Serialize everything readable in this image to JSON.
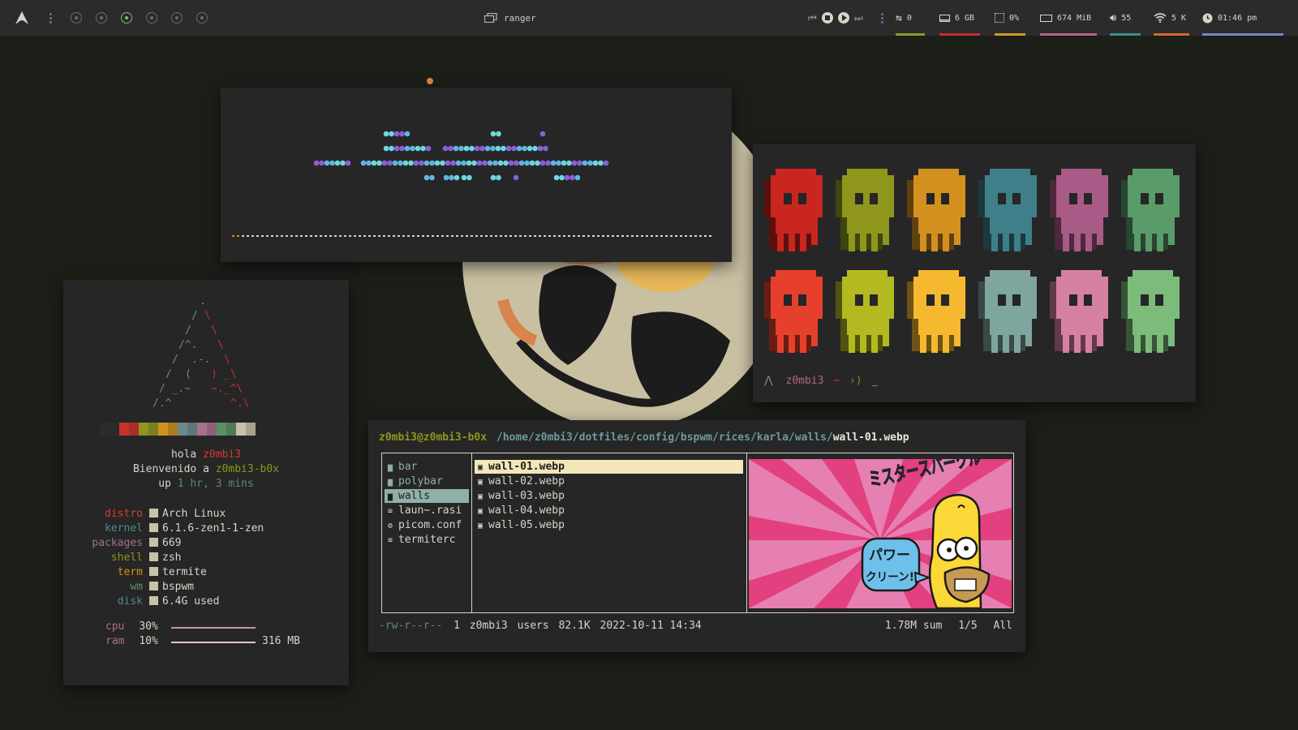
{
  "topbar": {
    "launcher_icon": "arch-icon",
    "workspaces": [
      {
        "id": 1,
        "active": false
      },
      {
        "id": 2,
        "active": false
      },
      {
        "id": 3,
        "active": true
      },
      {
        "id": 4,
        "active": false
      },
      {
        "id": 5,
        "active": false
      },
      {
        "id": 6,
        "active": false
      }
    ],
    "window_title": "ranger",
    "modules": {
      "updates": "0",
      "storage": "6 GB",
      "cpu": "0%",
      "memory": "674 MiB",
      "volume": "55",
      "network": "5 K",
      "clock": "01:46 pm"
    },
    "colors": {
      "updates": "#8b9a2f",
      "storage": "#c23030",
      "cpu": "#d19a2a",
      "memory": "#b3648a",
      "volume": "#3f8a8e",
      "network": "#d46a2a",
      "clock": "#7b83c9"
    }
  },
  "visualizer": {
    "icon": "audio-visualizer"
  },
  "colorscript": {
    "prompt_user": "z0mbi3",
    "prompt_path": "~",
    "prompt_symbol": "⟩",
    "cursor": "_",
    "skull_colors": [
      "#c8261f",
      "#8e961c",
      "#d2911f",
      "#3e7f8a",
      "#a85b86",
      "#5a9b6a",
      "#e6402c",
      "#b3b921",
      "#f5b82f",
      "#7ea59e",
      "#d680a2",
      "#7cbb7a"
    ]
  },
  "fetch": {
    "palette": [
      "#2c2c2c",
      "#c8312a",
      "#8e961c",
      "#d2911f",
      "#6d8a8a",
      "#a8708e",
      "#5a8f68",
      "#c9c2a8"
    ],
    "hola": "hola",
    "user": "z0mbi3",
    "bienvenido": "Bienvenido a",
    "host": "z0mbi3-b0x",
    "up_label": "up",
    "uptime_hr": "1",
    "uptime_hr_unit": "hr,",
    "uptime_min": "3",
    "uptime_min_unit": "mins",
    "info": [
      {
        "key": "distro",
        "value": "Arch Linux",
        "color": "#d63b2f"
      },
      {
        "key": "kernel",
        "value": "6.1.6-zen1-1-zen",
        "color": "#4f8a8e"
      },
      {
        "key": "packages",
        "value": "669",
        "color": "#a8708e"
      },
      {
        "key": "shell",
        "value": "zsh",
        "color": "#8e961c"
      },
      {
        "key": "term",
        "value": "termite",
        "color": "#d2911f"
      },
      {
        "key": "wm",
        "value": "bspwm",
        "color": "#5a8f68"
      },
      {
        "key": "disk",
        "value": "6.4G used",
        "color": "#4f8a8e"
      }
    ],
    "cpu_label": "cpu",
    "cpu_value": "30%",
    "ram_label": "ram",
    "ram_value": "10%",
    "ram_size": "316 MB"
  },
  "ranger": {
    "user_host": "z0mbi3@z0mbi3-b0x",
    "path": "/home/z0mbi3/dotfiles/config/bspwm/rices/karla/walls/",
    "file": "wall-01.webp",
    "parent_dir": [
      {
        "name": "bar",
        "type": "folder",
        "selected": false
      },
      {
        "name": "polybar",
        "type": "folder",
        "selected": false
      },
      {
        "name": "walls",
        "type": "folder",
        "selected": true
      },
      {
        "name": "laun~.rasi",
        "type": "file",
        "selected": false
      },
      {
        "name": "picom.conf",
        "type": "gear",
        "selected": false
      },
      {
        "name": "termiterc",
        "type": "file",
        "selected": false
      }
    ],
    "files": [
      {
        "name": "wall-01.webp",
        "selected": true
      },
      {
        "name": "wall-02.webp",
        "selected": false
      },
      {
        "name": "wall-03.webp",
        "selected": false
      },
      {
        "name": "wall-04.webp",
        "selected": false
      },
      {
        "name": "wall-05.webp",
        "selected": false
      }
    ],
    "preview": {
      "title_jp": "ミスタースパークル",
      "bubble_jp_1": "パワー",
      "bubble_jp_2": "クリーン!"
    },
    "status": {
      "perms": "-rw-r--r--",
      "links": "1",
      "owner": "z0mbi3",
      "group": "users",
      "size": "82.1K",
      "date": "2022-10-11 14:34",
      "sum": "1.78M sum",
      "pos": "1/5",
      "scroll": "All"
    }
  }
}
